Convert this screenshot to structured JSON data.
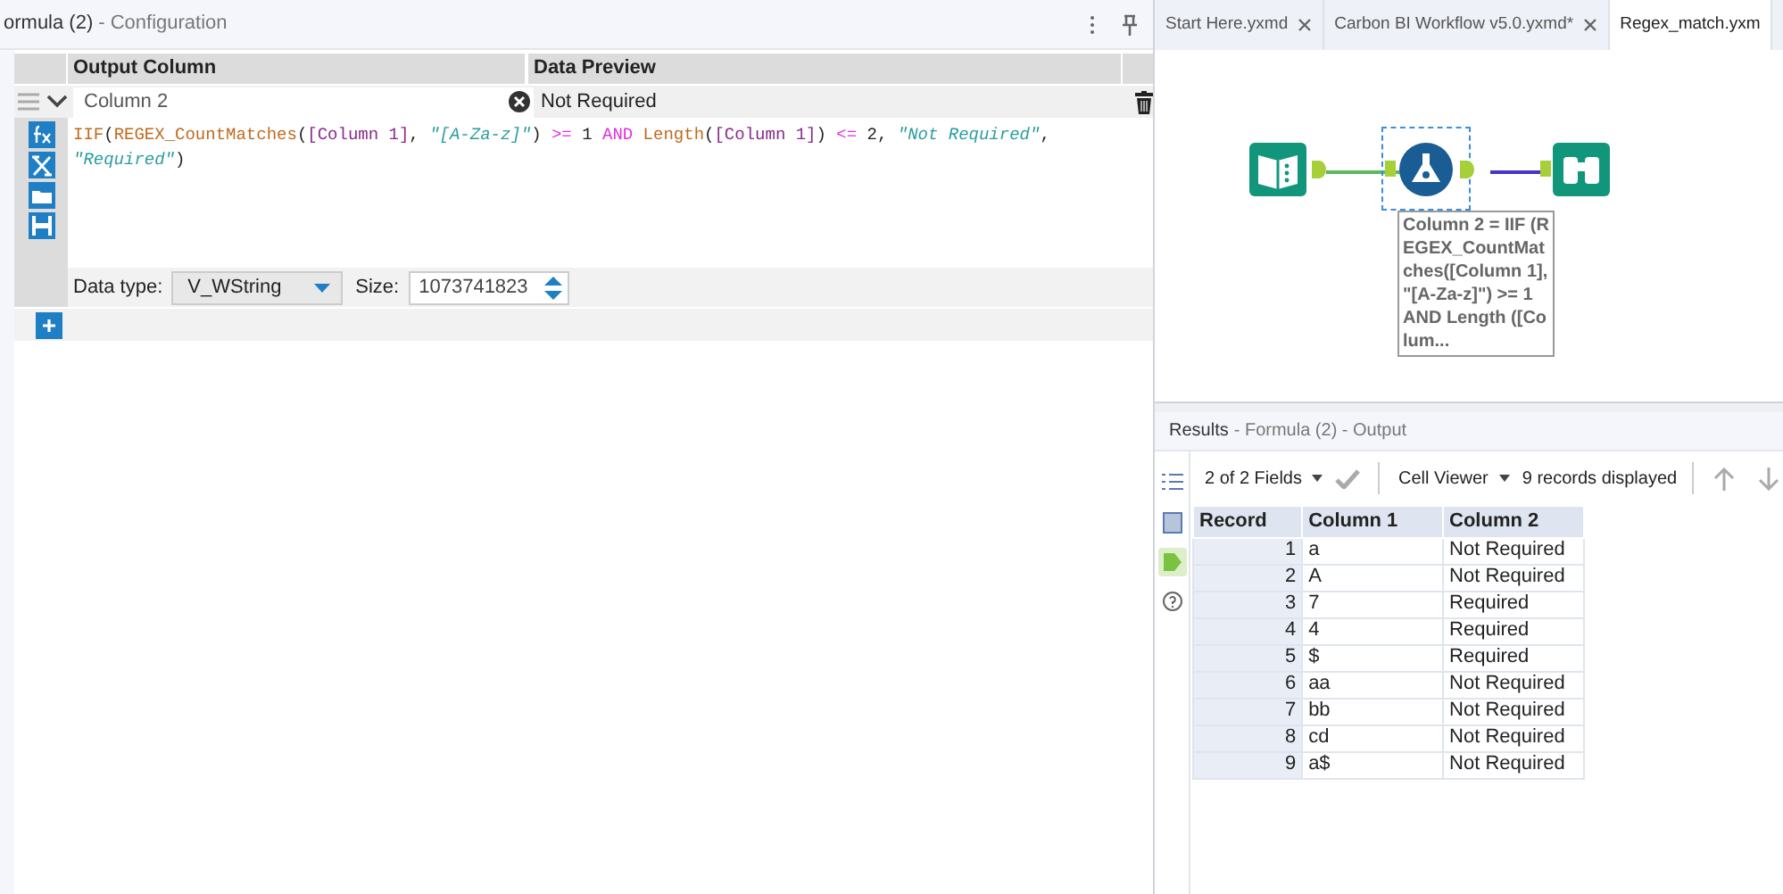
{
  "config_panel": {
    "title": "ormula (2)",
    "subtitle": "- Configuration"
  },
  "formula_table": {
    "columns": [
      "Output Column",
      "Data Preview"
    ],
    "rows": [
      {
        "output_column": "Column 2",
        "data_preview": "Not Required",
        "data_type_label": "Data type:",
        "data_type": "V_WString",
        "size_label": "Size:",
        "size": "1073741823",
        "expression_lines": [
          [
            {
              "kind": "function",
              "text": "IIF"
            },
            {
              "kind": "punct",
              "text": "("
            },
            {
              "kind": "function",
              "text": "REGEX_CountMatches"
            },
            {
              "kind": "punct",
              "text": "("
            },
            {
              "kind": "field",
              "text": "[Column 1]"
            },
            {
              "kind": "punct",
              "text": ", "
            },
            {
              "kind": "string",
              "text": "\"[A-Za-z]\""
            },
            {
              "kind": "punct",
              "text": ") "
            },
            {
              "kind": "operator",
              "text": ">="
            },
            {
              "kind": "number",
              "text": " 1"
            },
            {
              "kind": "operator",
              "text": " AND"
            },
            {
              "kind": "function",
              "text": " Length"
            },
            {
              "kind": "punct",
              "text": "("
            },
            {
              "kind": "field",
              "text": "[Column 1]"
            },
            {
              "kind": "punct",
              "text": ") "
            },
            {
              "kind": "operator",
              "text": "<="
            },
            {
              "kind": "number",
              "text": " 2"
            },
            {
              "kind": "punct",
              "text": ", "
            },
            {
              "kind": "string",
              "text": "\"Not Required\""
            },
            {
              "kind": "punct",
              "text": ","
            }
          ],
          [
            {
              "kind": "string",
              "text": "\"Required\""
            },
            {
              "kind": "punct",
              "text": ")"
            }
          ]
        ]
      }
    ]
  },
  "tabs": [
    {
      "label": "Start Here.yxmd",
      "selected": false,
      "closable": true
    },
    {
      "label": "Carbon BI Workflow v5.0.yxmd*",
      "selected": false,
      "closable": true
    },
    {
      "label": "Regex_match.yxm",
      "selected": true,
      "closable": false
    }
  ],
  "canvas": {
    "nodes": [
      {
        "kind": "input",
        "selected": false
      },
      {
        "kind": "formula",
        "selected": true
      },
      {
        "kind": "browse",
        "selected": false
      }
    ],
    "annotation": "Column 2 = IIF (REGEX_CountMatches([Column 1], \"[A-Za-z]\") >= 1 AND Length ([Colum..."
  },
  "results": {
    "title": "Results",
    "subtitle": "- Formula (2) - Output",
    "side_tools": [
      {
        "kind": "list",
        "selected": false
      },
      {
        "kind": "panel",
        "selected": false
      },
      {
        "kind": "tag",
        "selected": true
      },
      {
        "kind": "help",
        "selected": false
      }
    ],
    "fields": "2 of 2 Fields",
    "viewer": "Cell Viewer",
    "record_count": "9 records displayed",
    "columns": [
      "Record",
      "Column 1",
      "Column 2"
    ],
    "rows": [
      [
        "1",
        "a",
        "Not Required"
      ],
      [
        "2",
        "A",
        "Not Required"
      ],
      [
        "3",
        "7",
        "Required"
      ],
      [
        "4",
        "4",
        "Required"
      ],
      [
        "5",
        "$",
        "Required"
      ],
      [
        "6",
        "aa",
        "Not Required"
      ],
      [
        "7",
        "bb",
        "Not Required"
      ],
      [
        "8",
        "cd",
        "Not Required"
      ],
      [
        "9",
        "a$",
        "Not Required"
      ]
    ]
  }
}
